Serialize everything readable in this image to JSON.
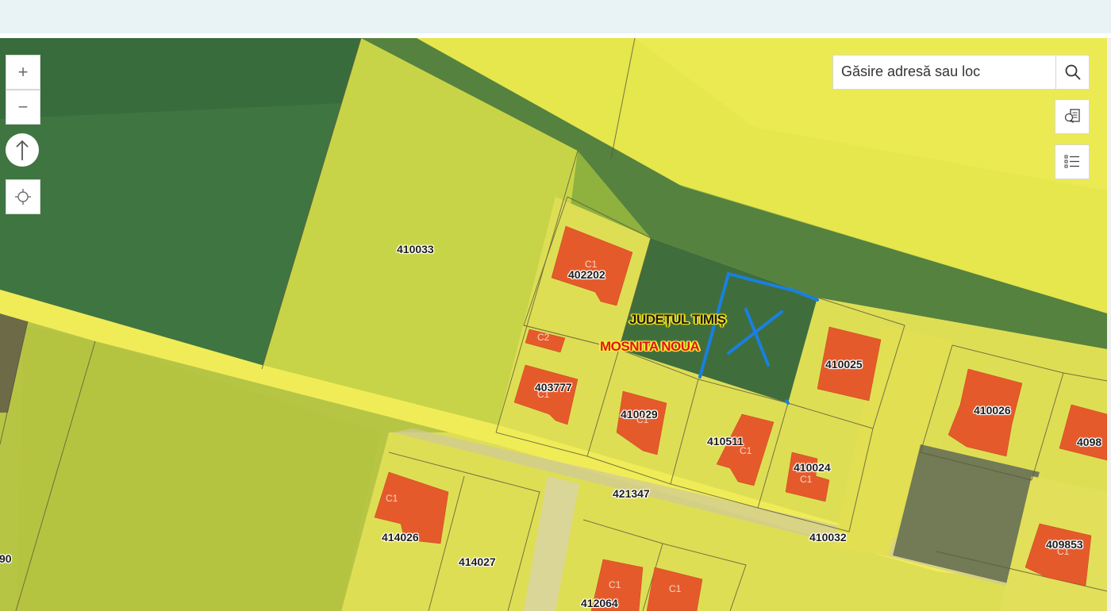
{
  "search": {
    "placeholder": "Găsire adresă sau loc"
  },
  "controls": {
    "zoom_in": "+",
    "zoom_out": "−"
  },
  "places": {
    "county": "JUDEȚUL TIMIȘ",
    "locality": "MOSNITA NOUA"
  },
  "parcels": {
    "p410033": "410033",
    "p402202": "402202",
    "p403777": "403777",
    "p410029": "410029",
    "p410511": "410511",
    "p410025": "410025",
    "p410024": "410024",
    "p410026": "410026",
    "p4098": "4098",
    "p421347": "421347",
    "p410032": "410032",
    "p414026": "414026",
    "p414027": "414027",
    "p412064": "412064",
    "p409853": "409853",
    "p90": "90"
  },
  "buildings": {
    "c1": "C1",
    "c2": "C2"
  },
  "colors": {
    "parcel_fill": "#e8e64a",
    "building": "#e55a2b",
    "selection": "#1a7fe0"
  }
}
